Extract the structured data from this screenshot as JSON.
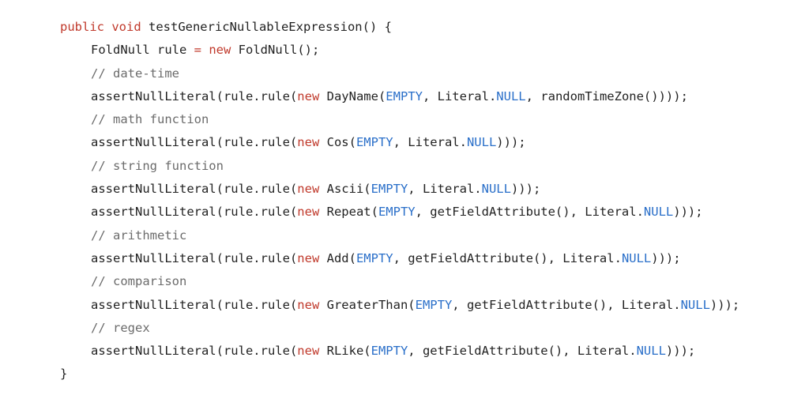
{
  "code": {
    "lines": [
      {
        "indent": 0,
        "tokens": [
          {
            "t": "kw",
            "v": "public void"
          },
          {
            "t": "plain",
            "v": " testGenericNullableExpression() {"
          }
        ]
      },
      {
        "indent": 1,
        "tokens": [
          {
            "t": "plain",
            "v": "FoldNull rule "
          },
          {
            "t": "kw",
            "v": "="
          },
          {
            "t": "plain",
            "v": " "
          },
          {
            "t": "kw",
            "v": "new"
          },
          {
            "t": "plain",
            "v": " FoldNull();"
          }
        ]
      },
      {
        "indent": 1,
        "tokens": [
          {
            "t": "comment",
            "v": "// date-time"
          }
        ]
      },
      {
        "indent": 1,
        "tokens": [
          {
            "t": "plain",
            "v": "assertNullLiteral(rule.rule("
          },
          {
            "t": "kw",
            "v": "new"
          },
          {
            "t": "plain",
            "v": " DayName("
          },
          {
            "t": "const",
            "v": "EMPTY"
          },
          {
            "t": "plain",
            "v": ", Literal."
          },
          {
            "t": "const",
            "v": "NULL"
          },
          {
            "t": "plain",
            "v": ", randomTimeZone())));"
          }
        ]
      },
      {
        "indent": 1,
        "tokens": [
          {
            "t": "comment",
            "v": "// math function"
          }
        ]
      },
      {
        "indent": 1,
        "tokens": [
          {
            "t": "plain",
            "v": "assertNullLiteral(rule.rule("
          },
          {
            "t": "kw",
            "v": "new"
          },
          {
            "t": "plain",
            "v": " Cos("
          },
          {
            "t": "const",
            "v": "EMPTY"
          },
          {
            "t": "plain",
            "v": ", Literal."
          },
          {
            "t": "const",
            "v": "NULL"
          },
          {
            "t": "plain",
            "v": ")));"
          }
        ]
      },
      {
        "indent": 1,
        "tokens": [
          {
            "t": "comment",
            "v": "// string function"
          }
        ]
      },
      {
        "indent": 1,
        "tokens": [
          {
            "t": "plain",
            "v": "assertNullLiteral(rule.rule("
          },
          {
            "t": "kw",
            "v": "new"
          },
          {
            "t": "plain",
            "v": " Ascii("
          },
          {
            "t": "const",
            "v": "EMPTY"
          },
          {
            "t": "plain",
            "v": ", Literal."
          },
          {
            "t": "const",
            "v": "NULL"
          },
          {
            "t": "plain",
            "v": ")));"
          }
        ]
      },
      {
        "indent": 1,
        "tokens": [
          {
            "t": "plain",
            "v": "assertNullLiteral(rule.rule("
          },
          {
            "t": "kw",
            "v": "new"
          },
          {
            "t": "plain",
            "v": " Repeat("
          },
          {
            "t": "const",
            "v": "EMPTY"
          },
          {
            "t": "plain",
            "v": ", getFieldAttribute(), Literal."
          },
          {
            "t": "const",
            "v": "NULL"
          },
          {
            "t": "plain",
            "v": ")));"
          }
        ]
      },
      {
        "indent": 1,
        "tokens": [
          {
            "t": "comment",
            "v": "// arithmetic"
          }
        ]
      },
      {
        "indent": 1,
        "tokens": [
          {
            "t": "plain",
            "v": "assertNullLiteral(rule.rule("
          },
          {
            "t": "kw",
            "v": "new"
          },
          {
            "t": "plain",
            "v": " Add("
          },
          {
            "t": "const",
            "v": "EMPTY"
          },
          {
            "t": "plain",
            "v": ", getFieldAttribute(), Literal."
          },
          {
            "t": "const",
            "v": "NULL"
          },
          {
            "t": "plain",
            "v": ")));"
          }
        ]
      },
      {
        "indent": 1,
        "tokens": [
          {
            "t": "comment",
            "v": "// comparison"
          }
        ]
      },
      {
        "indent": 1,
        "tokens": [
          {
            "t": "plain",
            "v": "assertNullLiteral(rule.rule("
          },
          {
            "t": "kw",
            "v": "new"
          },
          {
            "t": "plain",
            "v": " GreaterThan("
          },
          {
            "t": "const",
            "v": "EMPTY"
          },
          {
            "t": "plain",
            "v": ", getFieldAttribute(), Literal."
          },
          {
            "t": "const",
            "v": "NULL"
          },
          {
            "t": "plain",
            "v": ")));"
          }
        ]
      },
      {
        "indent": 1,
        "tokens": [
          {
            "t": "comment",
            "v": "// regex"
          }
        ]
      },
      {
        "indent": 1,
        "tokens": [
          {
            "t": "plain",
            "v": "assertNullLiteral(rule.rule("
          },
          {
            "t": "kw",
            "v": "new"
          },
          {
            "t": "plain",
            "v": " RLike("
          },
          {
            "t": "const",
            "v": "EMPTY"
          },
          {
            "t": "plain",
            "v": ", getFieldAttribute(), Literal."
          },
          {
            "t": "const",
            "v": "NULL"
          },
          {
            "t": "plain",
            "v": ")));"
          }
        ]
      },
      {
        "indent": 0,
        "tokens": [
          {
            "t": "plain",
            "v": "}"
          }
        ]
      }
    ]
  },
  "colors": {
    "keyword": "#c0392b",
    "constant": "#2a6fc9",
    "comment": "#6b6b6b",
    "text": "#222222",
    "background": "#ffffff"
  }
}
